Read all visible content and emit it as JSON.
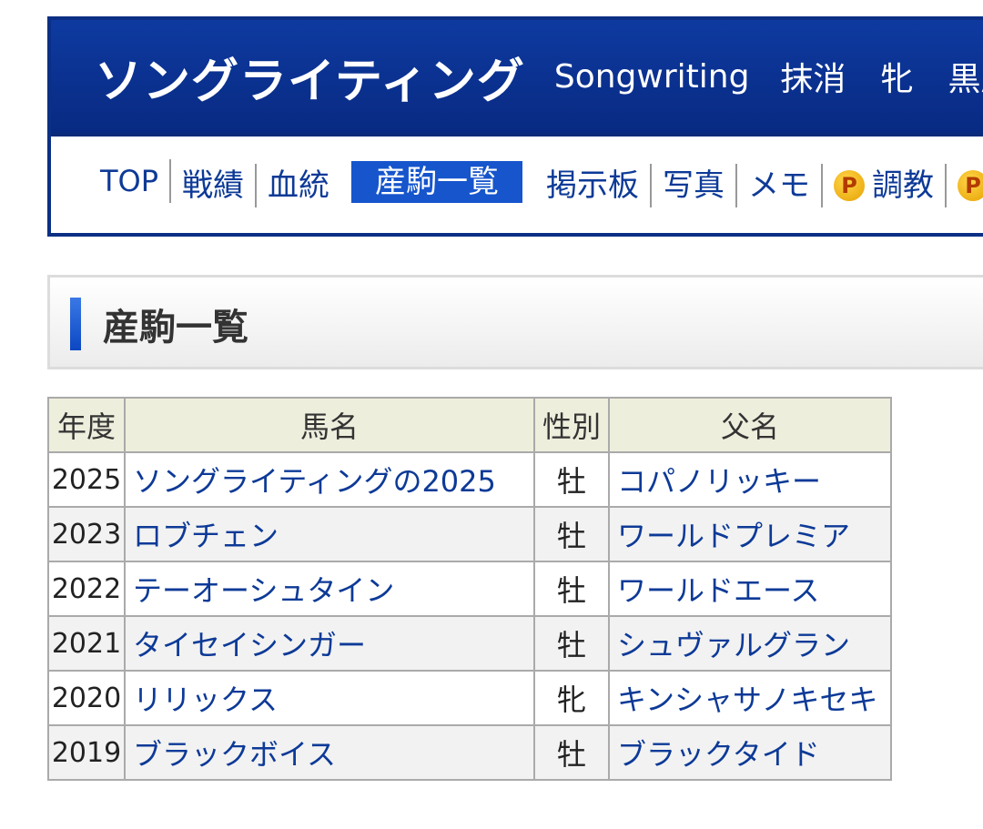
{
  "header": {
    "name": "ソングライティング",
    "english_name": "Songwriting",
    "status": "抹消",
    "sex": "牝",
    "coat_color": "黒鹿"
  },
  "nav": {
    "items": [
      "TOP",
      "戦績",
      "血統",
      "産駒一覧",
      "掲示板",
      "写真",
      "メモ",
      "調教",
      ""
    ],
    "active": "産駒一覧",
    "badge": "P"
  },
  "section": {
    "title": "産駒一覧"
  },
  "table": {
    "headers": [
      "年度",
      "馬名",
      "性別",
      "父名"
    ],
    "rows": [
      {
        "year": "2025",
        "name": "ソングライティングの2025",
        "sex": "牡",
        "sire": "コパノリッキー"
      },
      {
        "year": "2023",
        "name": "ロブチェン",
        "sex": "牡",
        "sire": "ワールドプレミア"
      },
      {
        "year": "2022",
        "name": "テーオーシュタイン",
        "sex": "牡",
        "sire": "ワールドエース"
      },
      {
        "year": "2021",
        "name": "タイセイシンガー",
        "sex": "牡",
        "sire": "シュヴァルグラン"
      },
      {
        "year": "2020",
        "name": "リリックス",
        "sex": "牝",
        "sire": "キンシャサノキセキ"
      },
      {
        "year": "2019",
        "name": "ブラックボイス",
        "sex": "牡",
        "sire": "ブラックタイド"
      }
    ]
  }
}
